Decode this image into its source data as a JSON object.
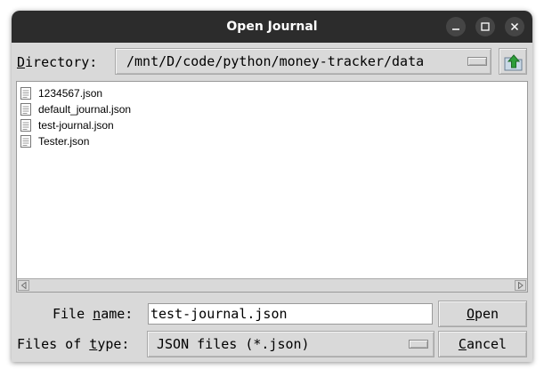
{
  "window": {
    "title": "Open Journal"
  },
  "window_controls": [
    "minimize-icon",
    "maximize-icon",
    "close-icon"
  ],
  "directory": {
    "label_mnemonic": "D",
    "label_rest": "irectory:",
    "path": "/mnt/D/code/python/money-tracker/data"
  },
  "files": [
    {
      "name": "1234567.json",
      "icon": "document-icon"
    },
    {
      "name": "default_journal.json",
      "icon": "document-icon"
    },
    {
      "name": "test-journal.json",
      "icon": "document-icon"
    },
    {
      "name": "Tester.json",
      "icon": "document-icon"
    }
  ],
  "file_name": {
    "label_pre": "File ",
    "label_mnemonic": "n",
    "label_post": "ame:",
    "value": "test-journal.json"
  },
  "file_type": {
    "label_pre": "Files of ",
    "label_mnemonic": "t",
    "label_post": "ype:",
    "selected": "JSON files (*.json)"
  },
  "buttons": {
    "open_mnemonic": "O",
    "open_rest": "pen",
    "cancel_mnemonic": "C",
    "cancel_rest": "ancel"
  },
  "colors": {
    "titlebar": "#2c2c2c",
    "dialog_bg": "#d9d9d9",
    "list_bg": "#ffffff",
    "up_arrow": "#2e9e3a"
  }
}
